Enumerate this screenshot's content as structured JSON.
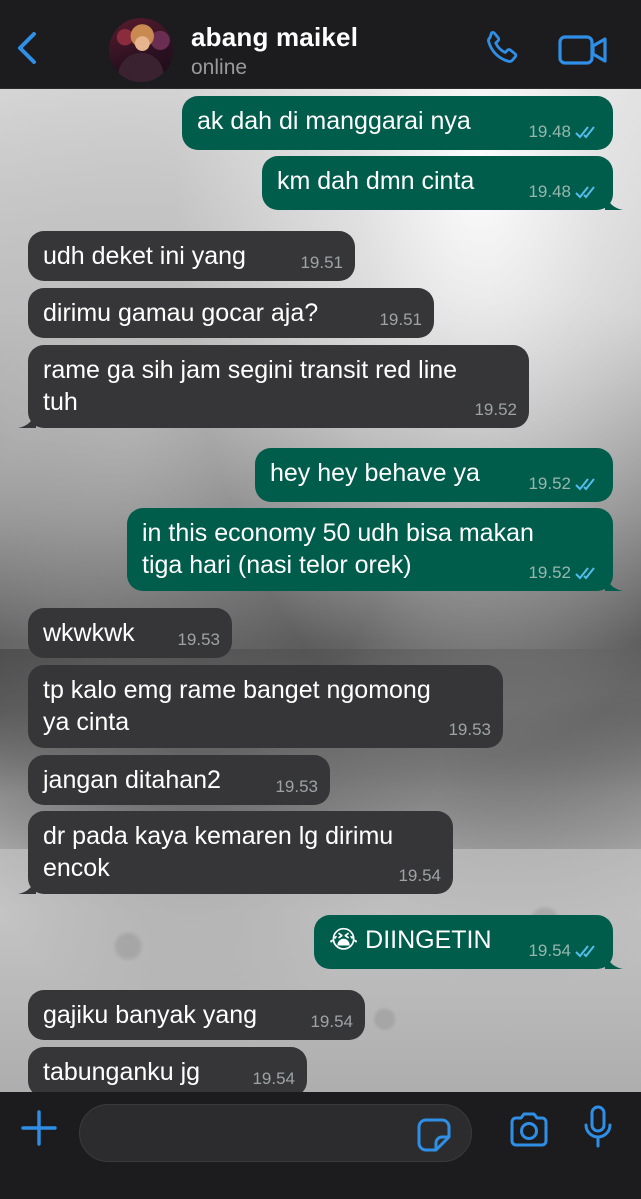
{
  "header": {
    "contact_name": "abang maikel",
    "status": "online",
    "icons": {
      "back": "chevron-left-icon",
      "call": "phone-icon",
      "video": "video-camera-icon"
    }
  },
  "colors": {
    "accent": "#2f8fe6",
    "outgoing_bubble": "#005c4b",
    "incoming_bubble": "#363638",
    "read_ticks": "#53bdeb"
  },
  "messages": [
    {
      "dir": "out",
      "text": "ak dah di manggarai nya",
      "time": "19.48",
      "read": true
    },
    {
      "dir": "out",
      "text": "km dah dmn cinta",
      "time": "19.48",
      "read": true
    },
    {
      "dir": "in",
      "text": "udh deket ini yang",
      "time": "19.51"
    },
    {
      "dir": "in",
      "text": "dirimu gamau gocar aja?",
      "time": "19.51"
    },
    {
      "dir": "in",
      "text": "rame ga sih jam segini transit red line\ntuh",
      "time": "19.52"
    },
    {
      "dir": "out",
      "text": "hey hey behave ya",
      "time": "19.52",
      "read": true
    },
    {
      "dir": "out",
      "text": "in this economy 50 udh bisa makan\ntiga hari (nasi telor orek)",
      "time": "19.52",
      "read": true
    },
    {
      "dir": "in",
      "text": "wkwkwk",
      "time": "19.53"
    },
    {
      "dir": "in",
      "text": "tp kalo emg rame banget ngomong\nya cinta",
      "time": "19.53"
    },
    {
      "dir": "in",
      "text": "jangan ditahan2",
      "time": "19.53"
    },
    {
      "dir": "in",
      "text": "dr pada kaya kemaren lg dirimu\nencok",
      "time": "19.54"
    },
    {
      "dir": "out",
      "text": "😭 DIINGETIN",
      "time": "19.54",
      "read": true
    },
    {
      "dir": "in",
      "text": "gajiku banyak yang",
      "time": "19.54"
    },
    {
      "dir": "in",
      "text": "tabunganku jg",
      "time": "19.54"
    }
  ],
  "input_bar": {
    "placeholder": "",
    "icons": {
      "attach": "plus-icon",
      "sticker": "sticker-icon",
      "camera": "camera-icon",
      "mic": "microphone-icon"
    }
  }
}
